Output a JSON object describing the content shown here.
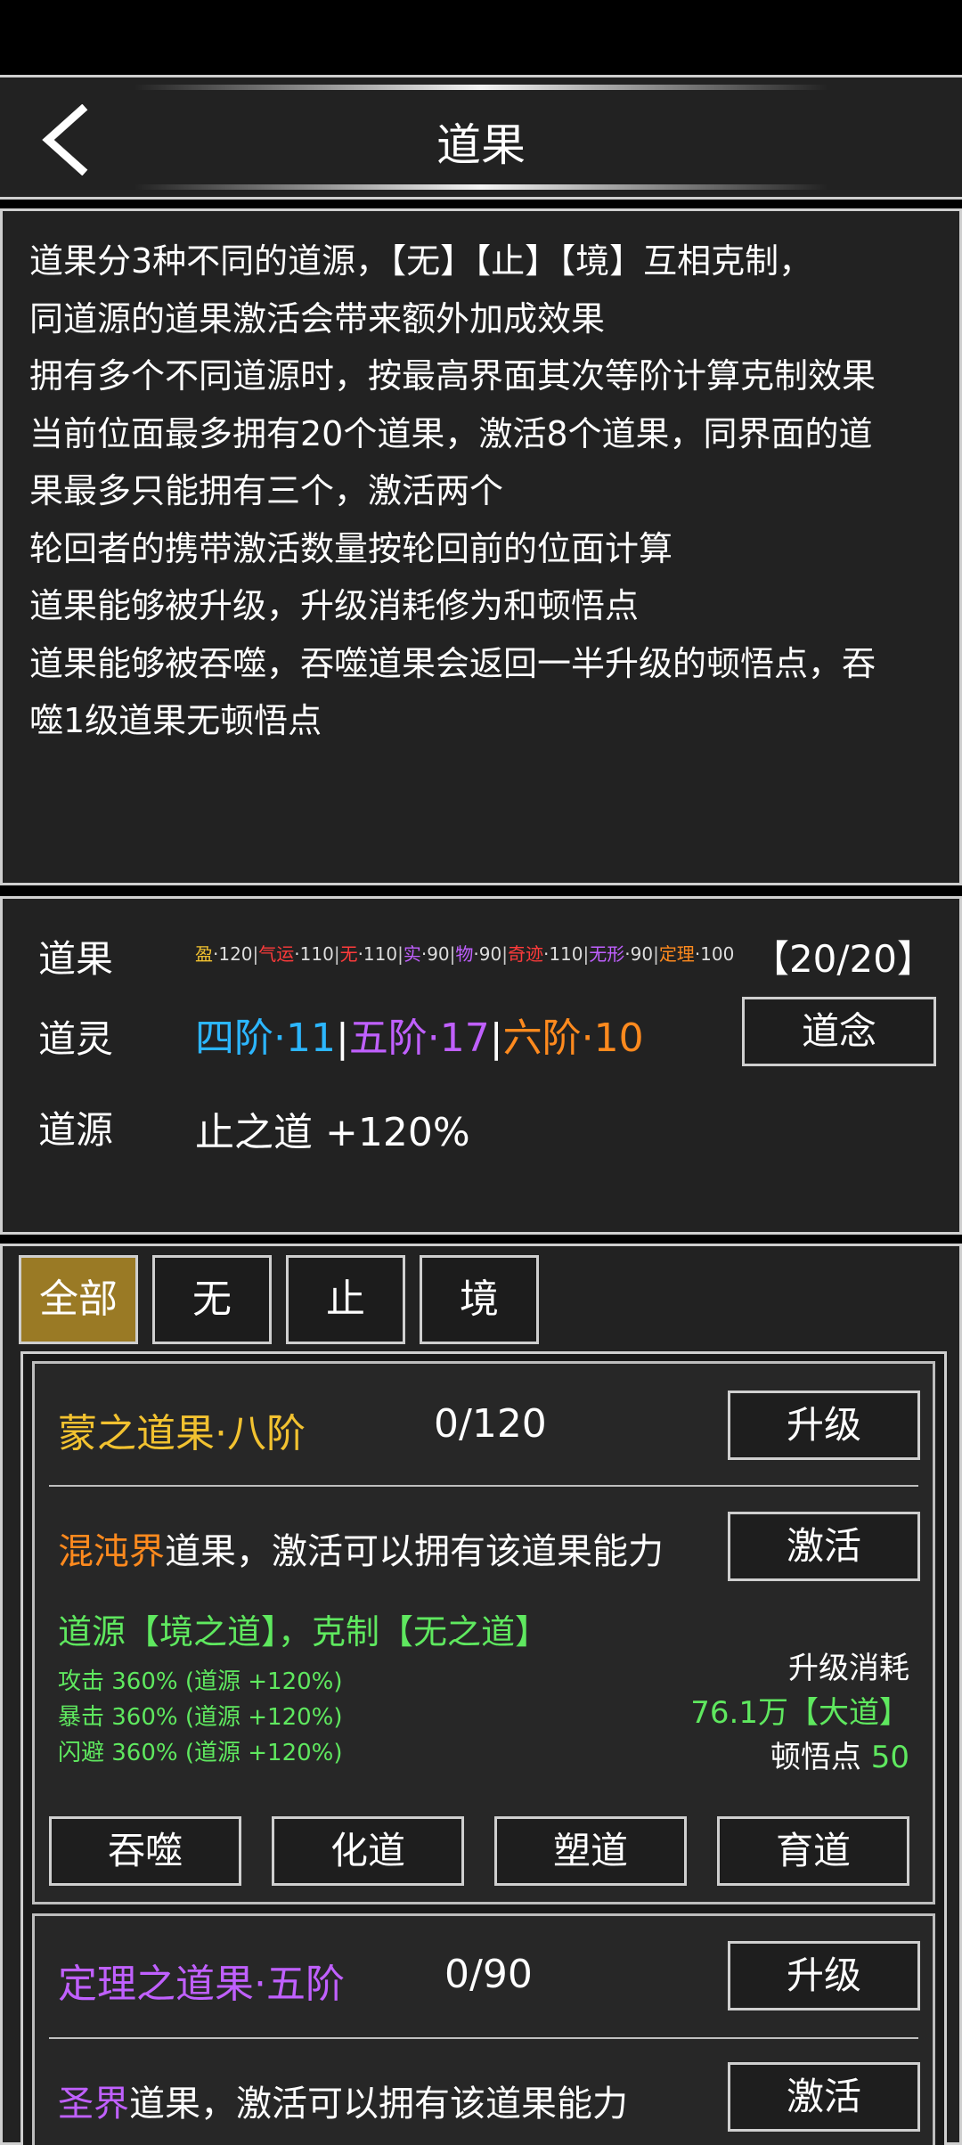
{
  "header": {
    "title": "道果"
  },
  "description": {
    "lines": [
      "道果分3种不同的道源，【无】【止】【境】互相克制，",
      "同道源的道果激活会带来额外加成效果",
      "拥有多个不同道源时，按最高界面其次等阶计算克制效果",
      "当前位面最多拥有20个道果，激活8个道果，同界面的道",
      "果最多只能拥有三个，激活两个",
      "轮回者的携带激活数量按轮回前的位面计算",
      "道果能够被升级，升级消耗修为和顿悟点",
      "道果能够被吞噬，吞噬道果会返回一半升级的顿悟点，吞",
      "噬1级道果无顿悟点"
    ]
  },
  "stats": {
    "daoguo_label": "道果",
    "daoguo_items": [
      {
        "name": "盈",
        "value": "120",
        "color": "#f2c230"
      },
      {
        "name": "气运",
        "value": "110",
        "color": "#ff3b3b"
      },
      {
        "name": "无",
        "value": "110",
        "color": "#ff3b3b"
      },
      {
        "name": "实",
        "value": "90",
        "color": "#c060ff"
      },
      {
        "name": "物",
        "value": "90",
        "color": "#c060ff"
      },
      {
        "name": "奇迹",
        "value": "110",
        "color": "#ff3b3b"
      },
      {
        "name": "无形",
        "value": "90",
        "color": "#c060ff"
      },
      {
        "name": "定理",
        "value": "100",
        "color": "#ff8a1e"
      }
    ],
    "daoguo_count": "【20/20】",
    "daoling_label": "道灵",
    "daoling_items": [
      {
        "text": "四阶·11",
        "color": "#2cb6ff"
      },
      {
        "text": "五阶·17",
        "color": "#c060ff"
      },
      {
        "text": "六阶·10",
        "color": "#ff8a1e"
      }
    ],
    "daonian_button": "道念",
    "daoyuan_label": "道源",
    "daoyuan_value": "止之道 +120%"
  },
  "tabs": [
    {
      "label": "全部",
      "active": true
    },
    {
      "label": "无",
      "active": false
    },
    {
      "label": "止",
      "active": false
    },
    {
      "label": "境",
      "active": false
    }
  ],
  "cards": [
    {
      "name": "蒙之道果·八阶",
      "name_color": "#f2c230",
      "progress": "0/120",
      "upgrade_button": "升级",
      "realm": "混沌界",
      "realm_color": "#ff8a1e",
      "realm_suffix": "道果，激活可以拥有该道果能力",
      "activate_button": "激活",
      "source": "道源【境之道】，克制【无之道】",
      "attrs": [
        "攻击 360% (道源 +120%)",
        "暴击 360% (道源 +120%)",
        "闪避 360% (道源 +120%)"
      ],
      "cost_label": "升级消耗",
      "cost_value": "76.1万【大道】",
      "insight_label": "顿悟点",
      "insight_value": "50",
      "actions": [
        "吞噬",
        "化道",
        "塑道",
        "育道"
      ]
    },
    {
      "name": "定理之道果·五阶",
      "name_color": "#c060ff",
      "progress": "0/90",
      "upgrade_button": "升级",
      "realm": "圣界",
      "realm_color": "#c060ff",
      "realm_suffix": "道果，激活可以拥有该道果能力",
      "activate_button": "激活"
    }
  ]
}
